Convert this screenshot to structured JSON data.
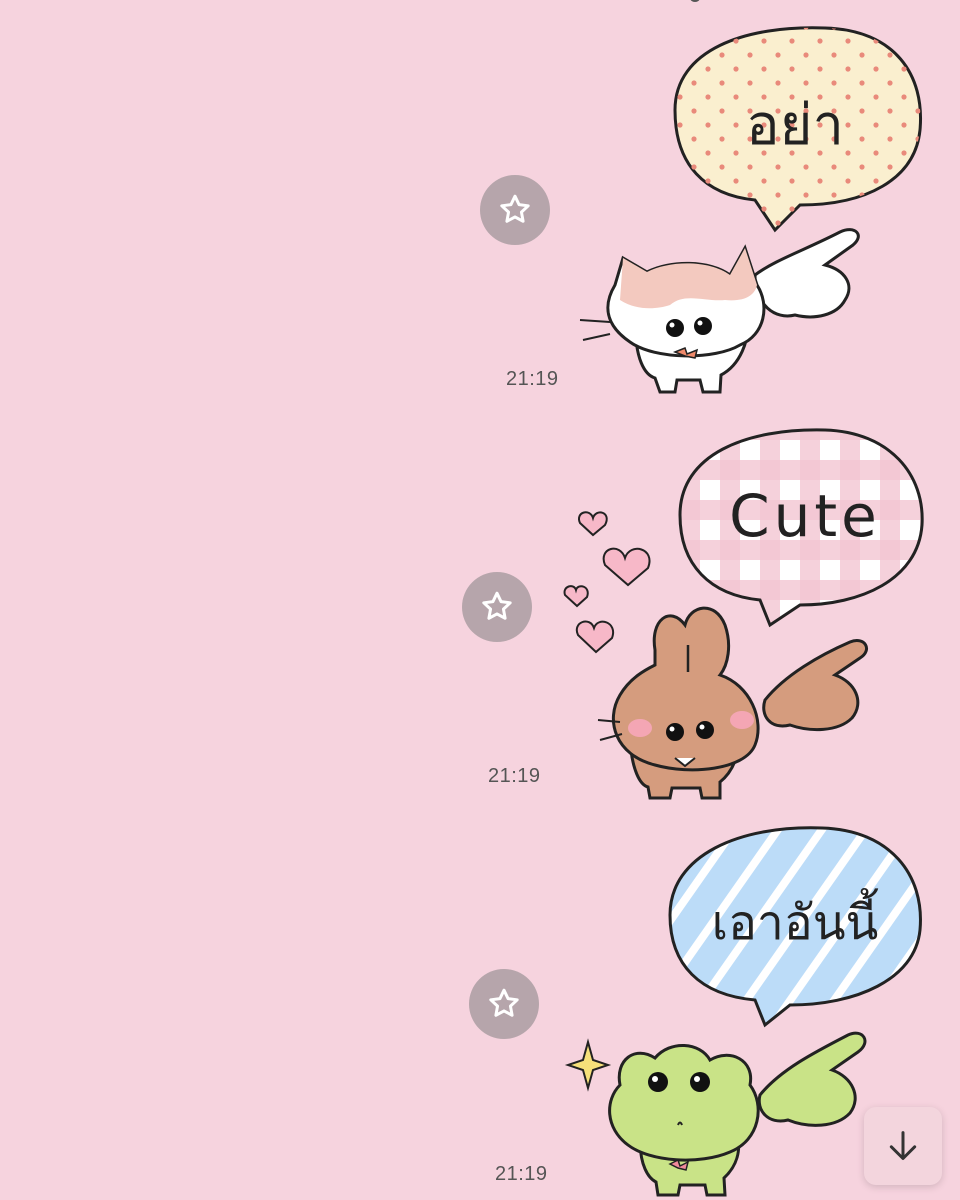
{
  "messages": [
    {
      "time": "21:19",
      "bubble_text": "อย่า",
      "character": "cat"
    },
    {
      "time": "21:19",
      "bubble_text": "Cute",
      "character": "rabbit"
    },
    {
      "time": "21:19",
      "bubble_text": "เอาอันนี้",
      "character": "frog"
    }
  ],
  "icons": {
    "favorite": "star-icon",
    "scroll": "arrow-down-icon"
  },
  "colors": {
    "background": "#f6d3de",
    "favorite_button": "#b6a5ab"
  }
}
